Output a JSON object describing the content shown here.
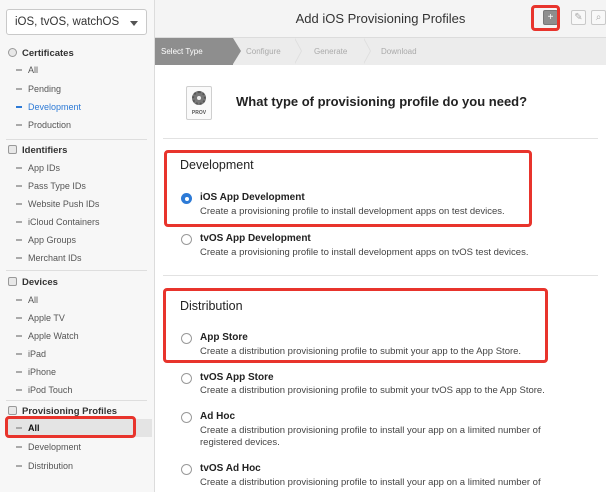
{
  "platform_selector": {
    "value": "iOS, tvOS, watchOS"
  },
  "sidebar": {
    "certificates": {
      "title": "Certificates",
      "items": [
        "All",
        "Pending",
        "Development",
        "Production"
      ]
    },
    "identifiers": {
      "title": "Identifiers",
      "items": [
        "App IDs",
        "Pass Type IDs",
        "Website Push IDs",
        "iCloud Containers",
        "App Groups",
        "Merchant IDs"
      ]
    },
    "devices": {
      "title": "Devices",
      "items": [
        "All",
        "Apple TV",
        "Apple Watch",
        "iPad",
        "iPhone",
        "iPod Touch"
      ]
    },
    "profiles": {
      "title": "Provisioning Profiles",
      "items": [
        "All",
        "Development",
        "Distribution"
      ]
    }
  },
  "header": {
    "title": "Add iOS Provisioning Profiles",
    "add_icon": "+",
    "edit_icon": "✎",
    "search_icon": "⌕"
  },
  "steps": [
    "Select Type",
    "Configure",
    "Generate",
    "Download"
  ],
  "main": {
    "icon_label": "PROV",
    "question": "What type of provisioning profile do you need?",
    "development": {
      "title": "Development",
      "options": [
        {
          "title": "iOS App Development",
          "desc": "Create a provisioning profile to install development apps on test devices.",
          "selected": true
        },
        {
          "title": "tvOS App Development",
          "desc": "Create a provisioning profile to install development apps on tvOS test devices.",
          "selected": false
        }
      ]
    },
    "distribution": {
      "title": "Distribution",
      "options": [
        {
          "title": "App Store",
          "desc": "Create a distribution provisioning profile to submit your app to the App Store."
        },
        {
          "title": "tvOS App Store",
          "desc": "Create a distribution provisioning profile to submit your tvOS app to the App Store."
        },
        {
          "title": "Ad Hoc",
          "desc": "Create a distribution provisioning profile to install your app on a limited number of registered devices."
        },
        {
          "title": "tvOS Ad Hoc",
          "desc": "Create a distribution provisioning profile to install your app on a limited number of"
        }
      ]
    }
  },
  "colors": {
    "accent": "#2d7ad6",
    "highlight": "#e8342c"
  }
}
